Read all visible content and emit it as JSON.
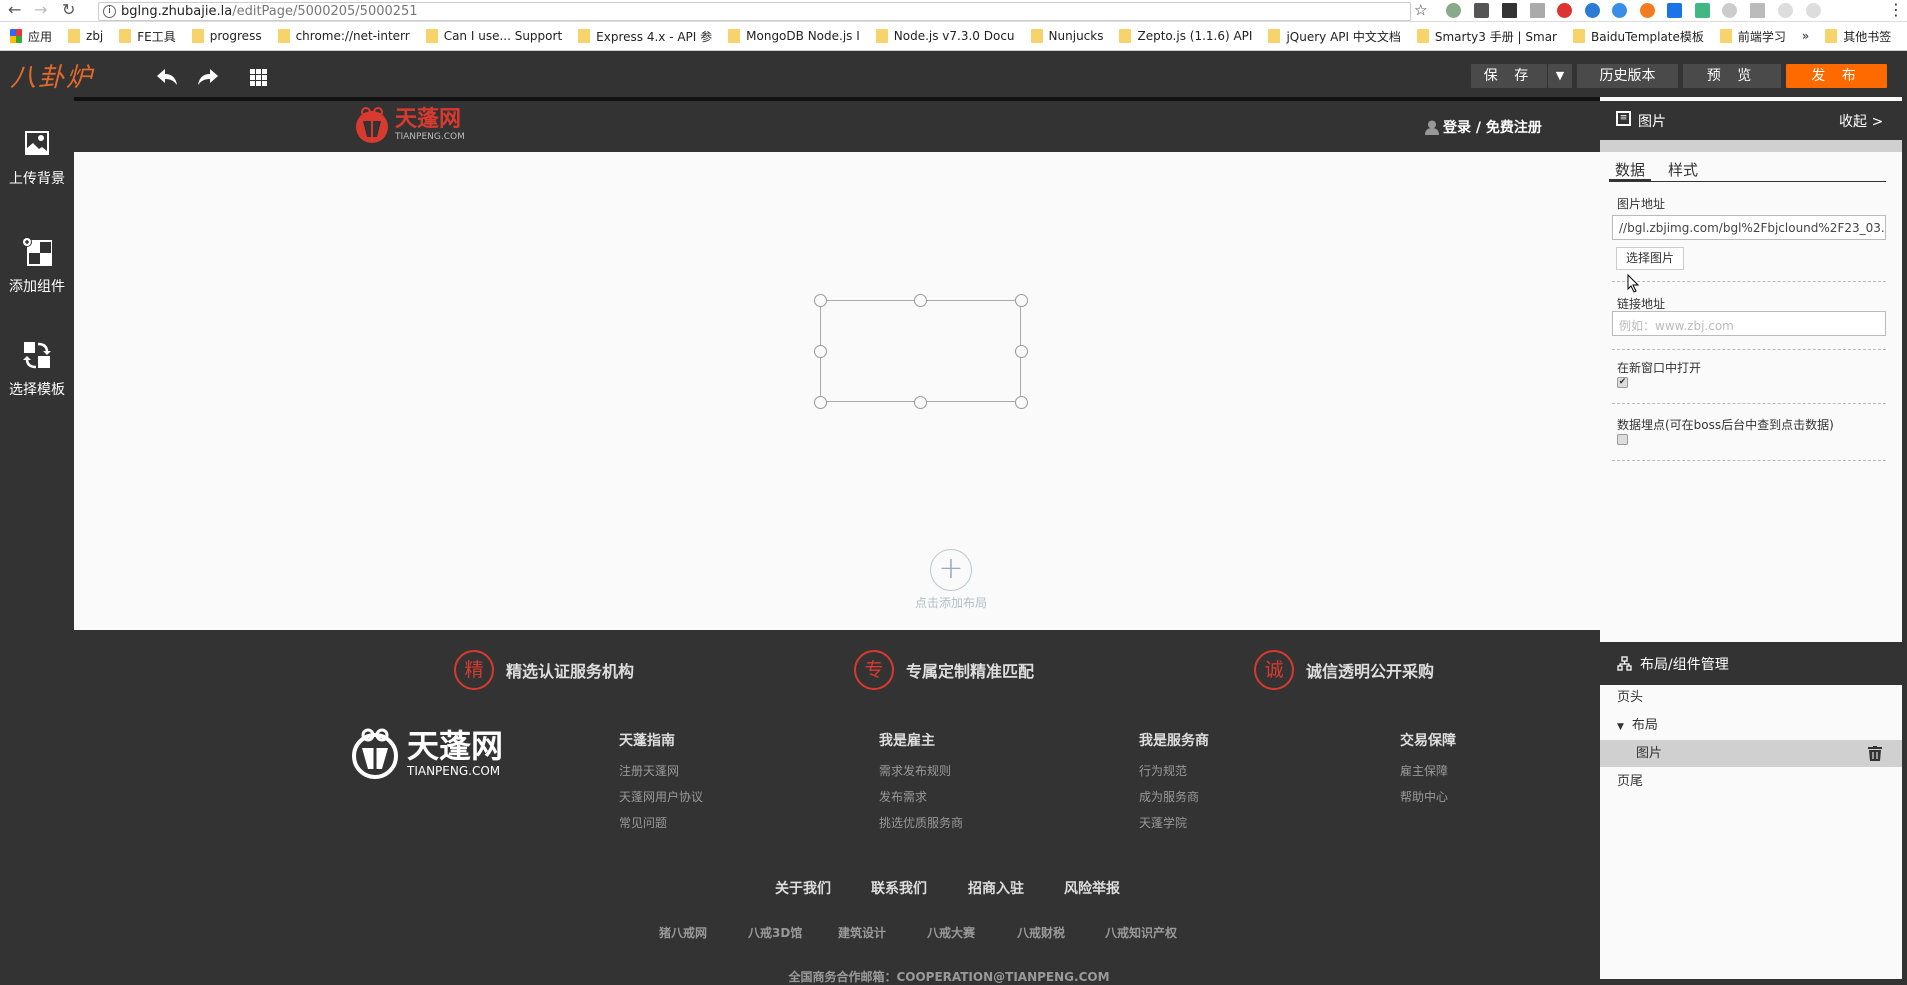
{
  "browser": {
    "url_host": "bglng.zhubajie.la",
    "url_path": "/editPage/5000205/5000251",
    "bookmarks": [
      "应用",
      "zbj",
      "FE工具",
      "progress",
      "chrome://net-interr",
      "Can I use... Support",
      "Express 4.x - API 参",
      "MongoDB Node.js I",
      "Node.js v7.3.0 Docu",
      "Nunjucks",
      "Zepto.js (1.1.6) API",
      "jQuery API 中文文档",
      "Smarty3 手册 | Smar",
      "BaiduTemplate模板",
      "前端学习",
      "»",
      "其他书签"
    ]
  },
  "toolbar": {
    "logo": "八卦炉",
    "save": "保 存",
    "history": "历史版本",
    "preview": "预 览",
    "publish": "发 布",
    "publish_color": "#ff6a00"
  },
  "sidebar": {
    "items": [
      {
        "label": "上传背景",
        "icon": "image-icon"
      },
      {
        "label": "添加组件",
        "icon": "add-component-icon"
      },
      {
        "label": "选择模板",
        "icon": "swap-template-icon"
      }
    ]
  },
  "site_header": {
    "logo_text": "天蓬网",
    "logo_sub": "TIANPENG.COM",
    "login": "登录 / 免费注册"
  },
  "canvas": {
    "add_layout": "点击添加布局"
  },
  "footer": {
    "features": [
      {
        "badge": "精",
        "text": "精选认证服务机构"
      },
      {
        "badge": "专",
        "text": "专属定制精准匹配"
      },
      {
        "badge": "诚",
        "text": "诚信透明公开采购"
      }
    ],
    "logo_text": "天蓬网",
    "logo_sub": "TIANPENG.COM",
    "columns": [
      {
        "title": "天蓬指南",
        "items": [
          "注册天蓬网",
          "天蓬网用户协议",
          "常见问题"
        ]
      },
      {
        "title": "我是雇主",
        "items": [
          "需求发布规则",
          "发布需求",
          "挑选优质服务商"
        ]
      },
      {
        "title": "我是服务商",
        "items": [
          "行为规范",
          "成为服务商",
          "天蓬学院"
        ]
      },
      {
        "title": "交易保障",
        "items": [
          "雇主保障",
          "帮助中心"
        ]
      }
    ],
    "links": [
      "关于我们",
      "联系我们",
      "招商入驻",
      "风险举报"
    ],
    "partners": [
      "猪八戒网",
      "八戒3D馆",
      "建筑设计",
      "八戒大赛",
      "八戒财税",
      "八戒知识产权"
    ],
    "email": "全国商务合作邮箱：COOPERATION@TIANPENG.COM"
  },
  "panel": {
    "title": "图片",
    "collapse": "收起 >",
    "tabs": [
      "数据",
      "样式"
    ],
    "image_url_label": "图片地址",
    "image_url_value": "//bgl.zbjimg.com/bgl%2Fbjclound%2F23_03.",
    "choose_image": "选择图片",
    "link_label": "链接地址",
    "link_placeholder": "例如：www.zbj.com",
    "new_window_label": "在新窗口中打开",
    "new_window_checked": true,
    "tracking_label": "数据埋点(可在boss后台中查到点击数据)",
    "tracking_checked": false
  },
  "layout_manager": {
    "title": "布局/组件管理",
    "items": [
      "页头",
      "布局",
      "图片",
      "页尾"
    ]
  }
}
